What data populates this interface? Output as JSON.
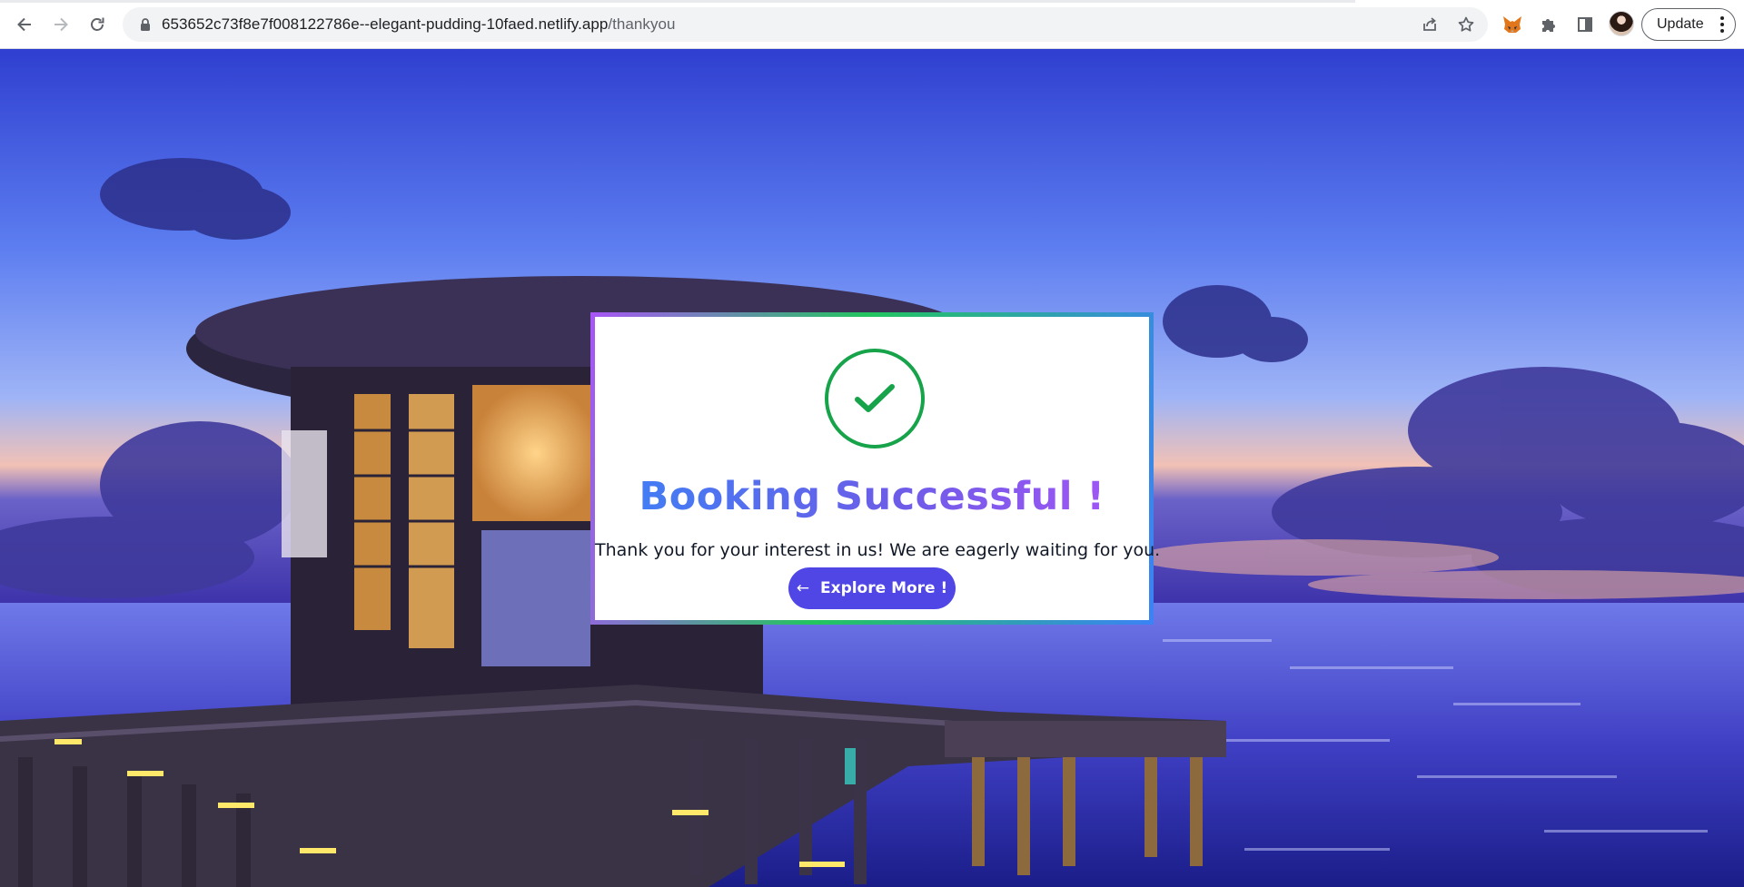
{
  "browser": {
    "url_host": "653652c73f8e7f008122786e--elegant-pudding-10faed.netlify.app",
    "url_path": "/thankyou",
    "update_label": "Update",
    "icons": {
      "back": "arrow-left-icon",
      "forward": "arrow-right-icon",
      "reload": "reload-icon",
      "lock": "lock-icon",
      "share": "share-icon",
      "bookmark": "star-icon",
      "metamask": "fox-icon",
      "extensions": "puzzle-icon",
      "side_panel": "side-panel-icon",
      "menu": "kebab-menu-icon"
    }
  },
  "card": {
    "title": "Booking Successful !",
    "message": "Thank you for your interest in us! We are eagerly waiting for you.",
    "button_arrow": "←",
    "button_label": "Explore More !",
    "colors": {
      "check": "#16a34a",
      "button": "#4f46e5",
      "title_gradient": [
        "#3b82f6",
        "#a855f7"
      ],
      "border_gradient": [
        "#a855f7",
        "#22c55e",
        "#3b82f6"
      ]
    }
  },
  "background": {
    "description_icon": "resort-overwater-villa-image"
  }
}
